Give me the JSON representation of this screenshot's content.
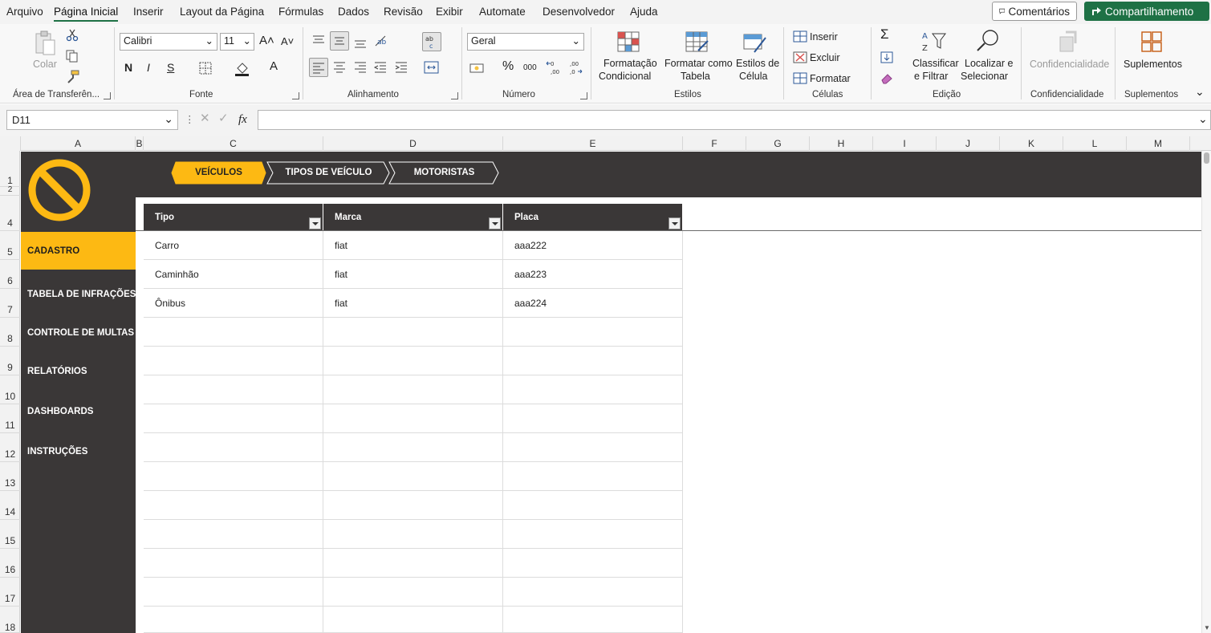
{
  "menu": {
    "items": [
      "Arquivo",
      "Página Inicial",
      "Inserir",
      "Layout da Página",
      "Fórmulas",
      "Dados",
      "Revisão",
      "Exibir",
      "Automate",
      "Desenvolvedor",
      "Ajuda"
    ],
    "comments_label": "Comentários",
    "share_label": "Compartilhamento"
  },
  "ribbon": {
    "clipboard": {
      "paste_label": "Colar",
      "group_label": "Área de Transferên..."
    },
    "font": {
      "font_name": "Calibri",
      "font_size": "11",
      "bold": "N",
      "italic": "I",
      "underline": "S",
      "group_label": "Fonte"
    },
    "alignment": {
      "group_label": "Alinhamento"
    },
    "number": {
      "format": "Geral",
      "percent": "%",
      "thousands": "000",
      "group_label": "Número"
    },
    "styles": {
      "conditional_line1": "Formatação",
      "conditional_line2": "Condicional",
      "format_table_line1": "Formatar como",
      "format_table_line2": "Tabela",
      "cell_styles_line1": "Estilos de",
      "cell_styles_line2": "Célula",
      "group_label": "Estilos"
    },
    "cells": {
      "insert": "Inserir",
      "delete": "Excluir",
      "format": "Formatar",
      "group_label": "Células"
    },
    "editing": {
      "sort_line1": "Classificar",
      "sort_line2": "e Filtrar",
      "find_line1": "Localizar e",
      "find_line2": "Selecionar",
      "group_label": "Edição"
    },
    "sensitivity": {
      "label": "Confidencialidade",
      "group_label": "Confidencialidade"
    },
    "addins": {
      "label": "Suplementos",
      "group_label": "Suplementos"
    }
  },
  "formula_bar": {
    "name_box": "D11",
    "fx": "fx",
    "value": ""
  },
  "columns": [
    "A",
    "B",
    "C",
    "D",
    "E",
    "F",
    "G",
    "H",
    "I",
    "J",
    "K",
    "L",
    "M"
  ],
  "rows": [
    "1",
    "2",
    "4",
    "5",
    "6",
    "7",
    "8",
    "9",
    "10",
    "11",
    "12",
    "13",
    "14",
    "15",
    "16",
    "17",
    "18"
  ],
  "app": {
    "tabs": [
      {
        "label": "VEÍCULOS",
        "active": true
      },
      {
        "label": "TIPOS DE VEÍCULO",
        "active": false
      },
      {
        "label": "MOTORISTAS",
        "active": false
      }
    ],
    "nav": [
      {
        "label": "CADASTRO",
        "active": true
      },
      {
        "label": "TABELA DE INFRAÇÕES",
        "active": false
      },
      {
        "label": "CONTROLE DE MULTAS",
        "active": false
      },
      {
        "label": "RELATÓRIOS",
        "active": false
      },
      {
        "label": "DASHBOARDS",
        "active": false
      },
      {
        "label": "INSTRUÇÕES",
        "active": false
      }
    ],
    "table": {
      "headers": [
        "Tipo",
        "Marca",
        "Placa"
      ],
      "rows": [
        [
          "Carro",
          "fiat",
          "aaa222"
        ],
        [
          "Caminhão",
          "fiat",
          "aaa223"
        ],
        [
          "Ônibus",
          "fiat",
          "aaa224"
        ]
      ]
    },
    "colors": {
      "accent": "#fdb913",
      "dark": "#3a3737",
      "excel_green": "#1e7145"
    }
  }
}
